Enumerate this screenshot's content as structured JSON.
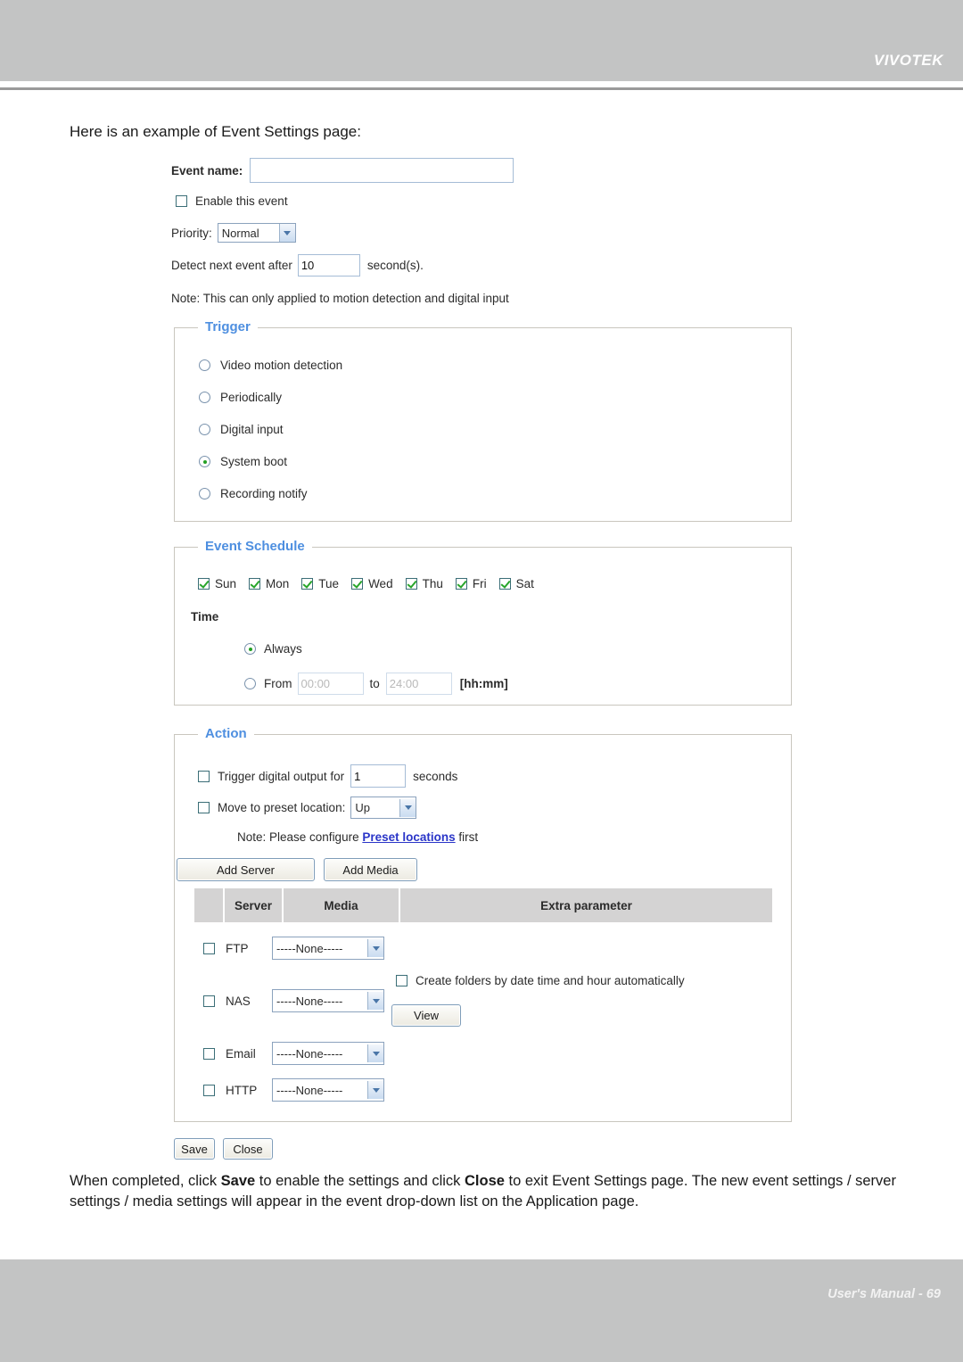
{
  "header": {
    "brand": "VIVOTEK"
  },
  "footer": {
    "text": "User's Manual - 69"
  },
  "intro_text": "Here is an example of Event Settings page:",
  "outro": {
    "part1": "When completed, click ",
    "save_bold": "Save",
    "part2": " to enable the settings and click ",
    "close_bold": "Close",
    "part3": " to exit Event Settings page. The new event settings / server settings / media settings will appear in the event drop-down list on the Application page."
  },
  "form": {
    "event_name_label": "Event name:",
    "event_name_value": "",
    "enable_event_label": "Enable this event",
    "enable_event_checked": false,
    "priority_label": "Priority:",
    "priority_value": "Normal",
    "priority_options": [
      "Normal"
    ],
    "detect_label": "Detect next event after",
    "detect_value": "10",
    "detect_suffix": "second(s).",
    "note": "Note: This can only applied to motion detection and digital input"
  },
  "trigger": {
    "legend": "Trigger",
    "options": [
      {
        "label": "Video motion detection",
        "selected": false
      },
      {
        "label": "Periodically",
        "selected": false
      },
      {
        "label": "Digital input",
        "selected": false
      },
      {
        "label": "System boot",
        "selected": true
      },
      {
        "label": "Recording notify",
        "selected": false
      }
    ]
  },
  "schedule": {
    "legend": "Event Schedule",
    "days": [
      {
        "label": "Sun",
        "checked": true
      },
      {
        "label": "Mon",
        "checked": true
      },
      {
        "label": "Tue",
        "checked": true
      },
      {
        "label": "Wed",
        "checked": true
      },
      {
        "label": "Thu",
        "checked": true
      },
      {
        "label": "Fri",
        "checked": true
      },
      {
        "label": "Sat",
        "checked": true
      }
    ],
    "time_label": "Time",
    "always_label": "Always",
    "always_selected": true,
    "from_label": "From",
    "from_value": "00:00",
    "to_label": "to",
    "to_value": "24:00",
    "format_hint": "[hh:mm]"
  },
  "action": {
    "legend": "Action",
    "trigger_do_label": "Trigger digital output for",
    "trigger_do_checked": false,
    "trigger_do_value": "1",
    "trigger_do_suffix": "seconds",
    "preset_label": "Move to preset location:",
    "preset_checked": false,
    "preset_value": "Up",
    "preset_options": [
      "Up"
    ],
    "note_prefix": "Note: Please configure ",
    "note_link": "Preset locations",
    "note_suffix": " first",
    "add_server_label": "Add Server",
    "add_media_label": "Add Media",
    "table": {
      "columns": [
        "",
        "Server",
        "Media",
        "Extra parameter"
      ],
      "rows": [
        {
          "checked": false,
          "server": "FTP",
          "media": "-----None-----",
          "extra": ""
        },
        {
          "checked": false,
          "server": "NAS",
          "media": "-----None-----",
          "extra": "Create folders by date time and hour automatically"
        },
        {
          "checked": false,
          "server": "Email",
          "media": "-----None-----",
          "extra": ""
        },
        {
          "checked": false,
          "server": "HTTP",
          "media": "-----None-----",
          "extra": ""
        }
      ],
      "nas_create_folders_checked": false,
      "view_button_label": "View"
    }
  },
  "buttons": {
    "save": "Save",
    "close": "Close"
  },
  "colors": {
    "band": "#c3c4c4",
    "legend_blue": "#4e8fe0",
    "check_green": "#27a52a",
    "link_blue": "#2a35c8",
    "table_header": "#d4d3d3"
  }
}
